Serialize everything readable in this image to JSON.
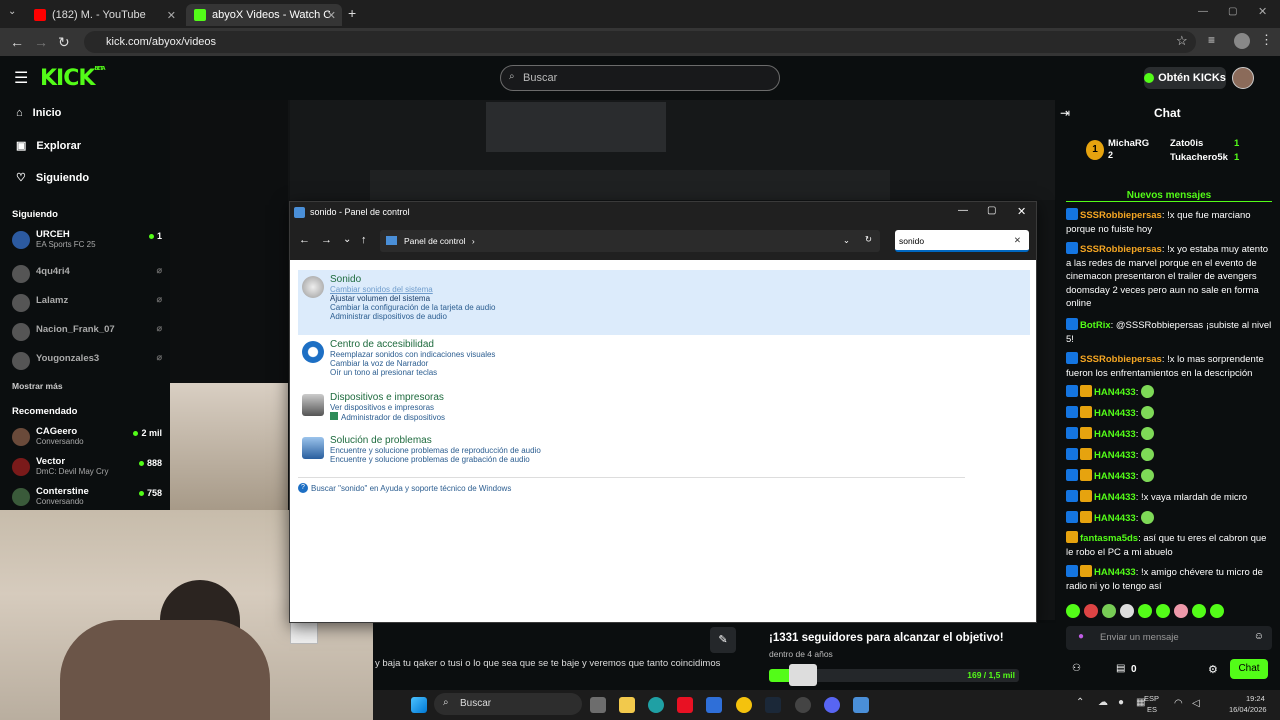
{
  "browser": {
    "tabs": [
      {
        "title": "(182) M. - YouTube",
        "color": "#ff0000"
      },
      {
        "title": "abyoX Videos - Watch On-Dem",
        "color": "#53fc18"
      }
    ],
    "new_tab": "+",
    "url": "kick.com/abyox/videos"
  },
  "kick": {
    "logo": "KICK",
    "beta": "BETA",
    "search_placeholder": "Buscar",
    "kicks_button": "Obtén KICKs"
  },
  "sidebar": {
    "nav": [
      {
        "label": "Inicio",
        "icon": "home-icon",
        "glyph": "⌂"
      },
      {
        "label": "Explorar",
        "icon": "compass-icon",
        "glyph": "▣"
      },
      {
        "label": "Siguiendo",
        "icon": "heart-icon",
        "glyph": "♡"
      }
    ],
    "following_title": "Siguiendo",
    "following": [
      {
        "name": "URCEH",
        "sub": "EA Sports FC 25",
        "viewers": "1",
        "live": true
      },
      {
        "name": "4qu4ri4",
        "sub": "",
        "viewers": "",
        "live": false
      },
      {
        "name": "Lalamz",
        "sub": "",
        "viewers": "",
        "live": false
      },
      {
        "name": "Nacion_Frank_07",
        "sub": "",
        "viewers": "",
        "live": false
      },
      {
        "name": "Yougonzales3",
        "sub": "",
        "viewers": "",
        "live": false
      }
    ],
    "show_more": "Mostrar más",
    "recommended_title": "Recomendado",
    "recommended": [
      {
        "name": "CAGeero",
        "sub": "Conversando",
        "viewers": "2 mil"
      },
      {
        "name": "Vector",
        "sub": "DmC: Devil May Cry",
        "viewers": "888"
      },
      {
        "name": "Conterstine",
        "sub": "Conversando",
        "viewers": "758"
      }
    ]
  },
  "control_panel": {
    "title": "sonido - Panel de control",
    "breadcrumb": "Panel de control",
    "search_value": "sonido",
    "groups": [
      {
        "title": "Sonido",
        "icon": "speaker-icon",
        "links": [
          "Cambiar sonidos del sistema",
          "Ajustar volumen del sistema",
          "Cambiar la configuración de la tarjeta de audio",
          "Administrar dispositivos de audio"
        ]
      },
      {
        "title": "Centro de accesibilidad",
        "icon": "accessibility-icon",
        "links": [
          "Reemplazar sonidos con indicaciones visuales",
          "Cambiar la voz de Narrador",
          "Oír un tono al presionar teclas"
        ]
      },
      {
        "title": "Dispositivos e impresoras",
        "icon": "printer-icon",
        "links": [
          "Ver dispositivos e impresoras",
          "Administrador de dispositivos"
        ]
      },
      {
        "title": "Solución de problemas",
        "icon": "troubleshoot-icon",
        "links": [
          "Encuentre y solucione problemas de reproducción de audio",
          "Encuentre y solucione problemas de grabación de audio"
        ]
      }
    ],
    "help_search": "Buscar \"sonido\" en Ayuda y soporte técnico de Windows"
  },
  "chat": {
    "title": "Chat",
    "top": [
      {
        "name": "MichaRG",
        "count": "2"
      },
      {
        "name": "Zato0is",
        "count": "1"
      },
      {
        "name": "Tukachero5k",
        "count": "1"
      }
    ],
    "new_messages": "Nuevos mensajes",
    "messages": [
      {
        "user": "SSSRobbiepersas",
        "text": "!x que fue marciano porque no fuiste hoy",
        "color": "#f5a623",
        "badges": [
          "b1"
        ]
      },
      {
        "user": "SSSRobbiepersas",
        "text": "!x yo estaba muy atento a las redes de marvel porque en el evento de cinemacon presentaron el trailer de avengers doomsday 2 veces pero aun no sale en forma online",
        "color": "#f5a623",
        "badges": [
          "b1"
        ]
      },
      {
        "user": "BotRix",
        "text": "@SSSRobbiepersas ¡subiste al nivel 5!",
        "color": "#53fc18",
        "badges": [
          "b1"
        ]
      },
      {
        "user": "SSSRobbiepersas",
        "text": "!x lo mas sorprendente fueron los enfrentamientos en la descripción",
        "color": "#f5a623",
        "badges": [
          "b1"
        ]
      },
      {
        "user": "HAN4433",
        "text": "",
        "color": "#53fc18",
        "badges": [
          "b1",
          "b2"
        ]
      },
      {
        "user": "HAN4433",
        "text": "",
        "color": "#53fc18",
        "badges": [
          "b1",
          "b2"
        ]
      },
      {
        "user": "HAN4433",
        "text": "",
        "color": "#53fc18",
        "badges": [
          "b1",
          "b2"
        ]
      },
      {
        "user": "HAN4433",
        "text": "",
        "color": "#53fc18",
        "badges": [
          "b1",
          "b2"
        ]
      },
      {
        "user": "HAN4433",
        "text": "",
        "color": "#53fc18",
        "badges": [
          "b1",
          "b2"
        ]
      },
      {
        "user": "HAN4433",
        "text": "!x vaya mlardah de micro",
        "color": "#53fc18",
        "badges": [
          "b1",
          "b2"
        ]
      },
      {
        "user": "HAN4433",
        "text": "",
        "color": "#53fc18",
        "badges": [
          "b1",
          "b2"
        ]
      },
      {
        "user": "fantasma5ds",
        "text": "así que tu eres el cabron que le robo el PC a mi abuelo",
        "color": "#53fc18",
        "badges": [
          "b2"
        ]
      },
      {
        "user": "HAN4433",
        "text": "!x amigo chévere tu micro de radio ni yo lo tengo así",
        "color": "#53fc18",
        "badges": [
          "b1",
          "b2"
        ]
      }
    ],
    "input_placeholder": "Enviar un mensaje",
    "points": "0",
    "send_button": "Chat"
  },
  "stream": {
    "goal_title": "¡1331 seguidores para alcanzar el objetivo!",
    "goal_sub": "dentro de 4 años",
    "goal_count": "169 / 1,5 mil",
    "goal_progress": 0.113,
    "subtitle": "y baja tu qaker o tusi o lo que sea que se te baje y veremos que tanto coincidimos"
  },
  "taskbar": {
    "search": "Buscar",
    "lang": "ESP",
    "lang2": "ES",
    "time": "19:24",
    "date": "16/04/2026"
  }
}
